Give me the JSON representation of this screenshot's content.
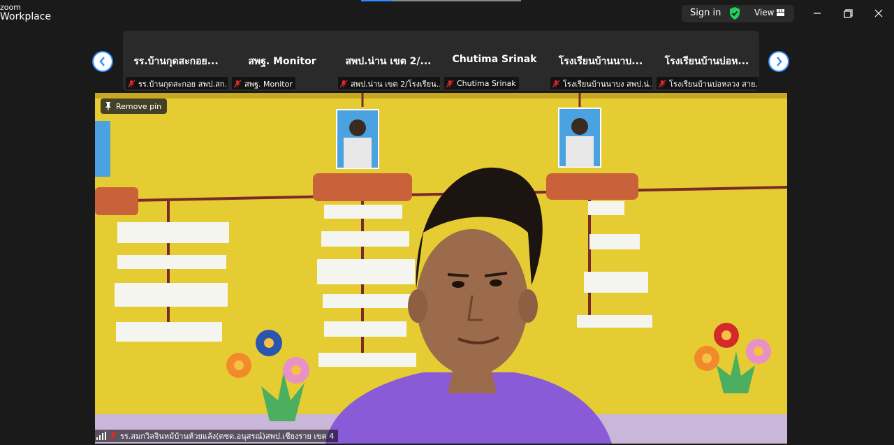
{
  "app": {
    "logo_top": "zoom",
    "logo_bottom": "Workplace",
    "sign_in_label": "Sign in",
    "view_label": "View"
  },
  "window_controls": {
    "minimize": "minimize-icon",
    "restore": "restore-icon",
    "close": "close-icon"
  },
  "gallery": {
    "tiles": [
      {
        "name": "รร.บ้านกุดสะกอย...",
        "label": "รร.บ้านกุดสะกอย สพป.สก..."
      },
      {
        "name": "สพฐ. Monitor",
        "label": "สพฐ. Monitor"
      },
      {
        "name": "สพป.น่าน เขต 2/...",
        "label": "สพป.น่าน เขต 2/โรงเรียน..."
      },
      {
        "name": "Chutima Srinak",
        "label": "Chutima Srinak"
      },
      {
        "name": "โรงเรียนบ้านนาบ...",
        "label": "โรงเรียนบ้านนาบง สพป.น่..."
      },
      {
        "name": "โรงเรียนบ้านบ่อห...",
        "label": "โรงเรียนบ้านบ่อหลวง สาย..."
      }
    ]
  },
  "main_video": {
    "remove_pin_label": "Remove pin",
    "participant_label": "รร.สมกวิลจินหม้บ้านห้วยแล้ง(ตชด.อนุสรณ์)สพป.เชียงราย เขต 4"
  },
  "colors": {
    "accent": "#2d8cff",
    "secure_green": "#23d160",
    "muted_red": "#e02828",
    "background": "#1a1a1a",
    "tile_bg": "#2a2a2a"
  }
}
